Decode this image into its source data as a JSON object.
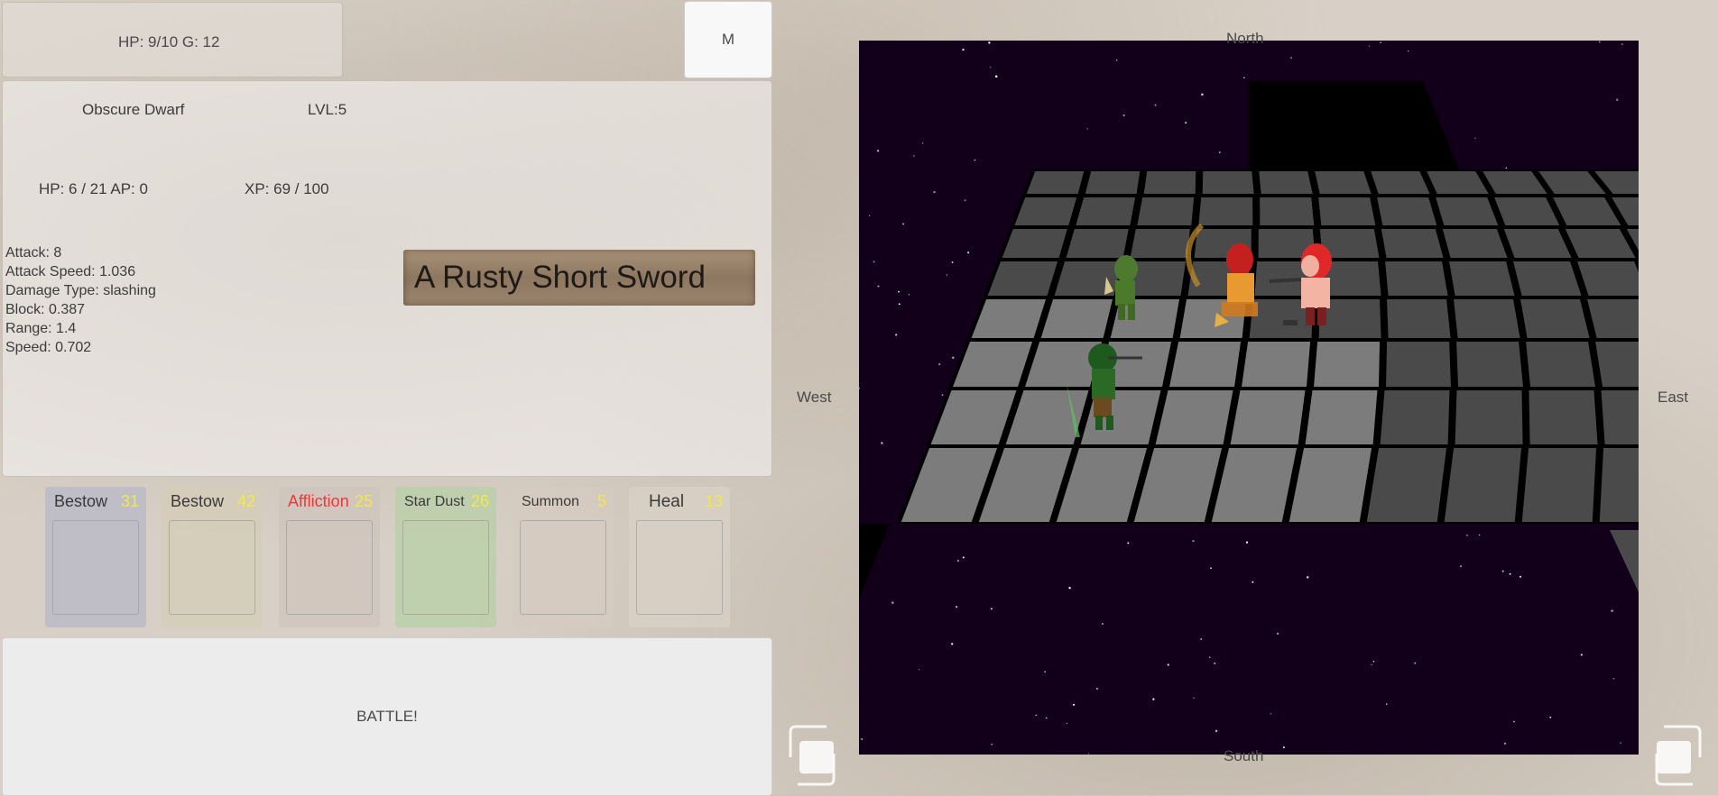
{
  "hud": {
    "status": "HP: 9/10 G: 12",
    "menu_label": "M"
  },
  "character": {
    "name": "Obscure Dwarf",
    "level": "LVL:5",
    "hp_ap": "HP: 6 / 21 AP: 0",
    "xp": "XP: 69 / 100",
    "stats": [
      "Attack: 8",
      "Attack Speed: 1.036",
      "Damage Type: slashing",
      "Block: 0.387",
      "Range: 1.4",
      "Speed: 0.702"
    ],
    "weapon": "A Rusty Short Sword"
  },
  "cards": [
    {
      "title": "Bestow",
      "cost": "31",
      "title_color": "#3a3a3a",
      "tint": "#b9b9c6"
    },
    {
      "title": "Bestow",
      "cost": "42",
      "title_color": "#3a3a3a",
      "tint": "#d4cdb8"
    },
    {
      "title": "Affliction",
      "cost": "25",
      "title_color": "#e83a3a",
      "tint": "#cfc4bd"
    },
    {
      "title": "Star Dust",
      "cost": "26",
      "title_color": "#3a3a3a",
      "tint": "#b9d0a8"
    },
    {
      "title": "Summon",
      "cost": "5",
      "title_color": "#3a3a3a",
      "tint": "#d6cbc0"
    },
    {
      "title": "Heal",
      "cost": "13",
      "title_color": "#3a3a3a",
      "tint": "#d8cfc5"
    }
  ],
  "battle_label": "BATTLE!",
  "compass": {
    "north": "North",
    "south": "South",
    "west": "West",
    "east": "East"
  },
  "colors": {
    "space": "#12001a",
    "tile_light": "#7c7c7c",
    "tile_dark": "#4a4a4a",
    "grid_line": "#000000"
  }
}
